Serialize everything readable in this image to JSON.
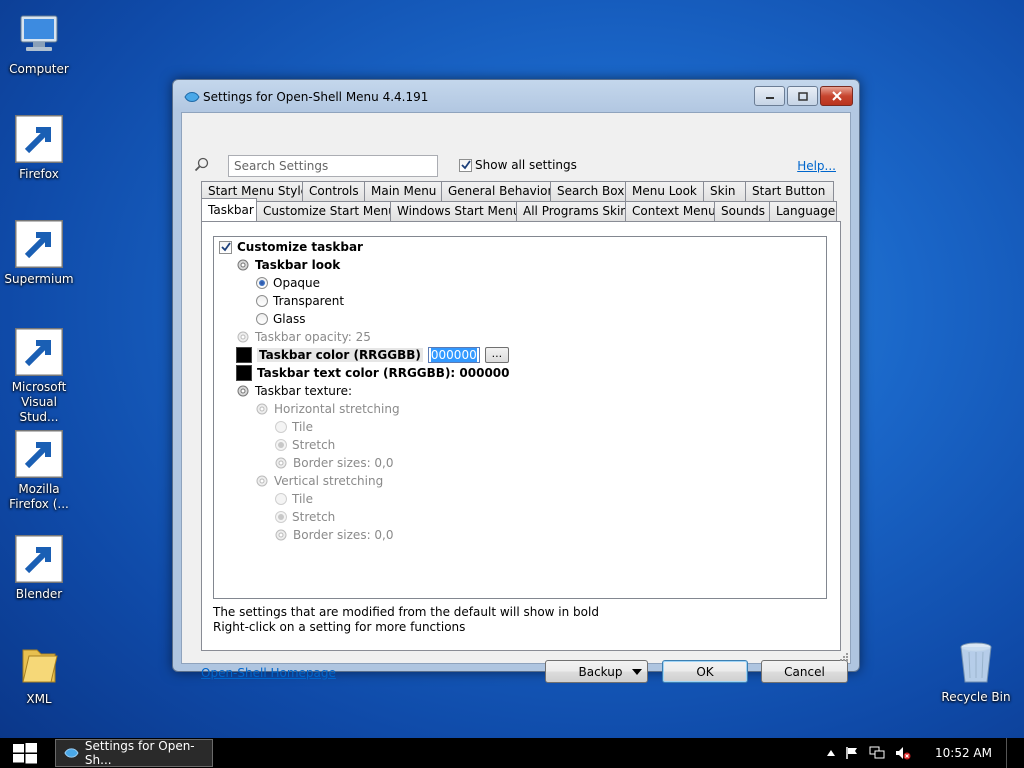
{
  "desktop": {
    "icons": [
      {
        "label": "Computer"
      },
      {
        "label": "Firefox"
      },
      {
        "label": "Supermium"
      },
      {
        "label": "Microsoft Visual Stud..."
      },
      {
        "label": "Mozilla Firefox (..."
      },
      {
        "label": "Blender"
      },
      {
        "label": "XML"
      },
      {
        "label": "Recycle Bin"
      }
    ]
  },
  "window": {
    "title": "Settings for Open-Shell Menu 4.4.191",
    "search_placeholder": "Search Settings",
    "show_all_label": "Show all settings",
    "help_label": "Help...",
    "tabs_row1": [
      "Start Menu Style",
      "Controls",
      "Main Menu",
      "General Behavior",
      "Search Box",
      "Menu Look",
      "Skin",
      "Start Button"
    ],
    "tabs_row2": [
      "Taskbar",
      "Customize Start Menu",
      "Windows Start Menu",
      "All Programs Skin",
      "Context Menu",
      "Sounds",
      "Language"
    ],
    "active_tab": "Taskbar",
    "tree": {
      "customize_taskbar": "Customize taskbar",
      "taskbar_look": "Taskbar look",
      "opaque": "Opaque",
      "transparent": "Transparent",
      "glass": "Glass",
      "taskbar_opacity": "Taskbar opacity: 25",
      "taskbar_color_label": "Taskbar color (RRGGBB)",
      "taskbar_color_value": "000000",
      "browse_label": "...",
      "taskbar_text_color": "Taskbar text color (RRGGBB): 000000",
      "taskbar_texture": "Taskbar texture:",
      "horizontal_stretching": "Horizontal stretching",
      "h_tile": "Tile",
      "h_stretch": "Stretch",
      "h_border": "Border sizes: 0,0",
      "vertical_stretching": "Vertical stretching",
      "v_tile": "Tile",
      "v_stretch": "Stretch",
      "v_border": "Border sizes: 0,0"
    },
    "info_line1": "The settings that are modified from the default will show in bold",
    "info_line2": "Right-click on a setting for more functions",
    "homepage_label": "Open-Shell Homepage",
    "backup_label": "Backup",
    "ok_label": "OK",
    "cancel_label": "Cancel"
  },
  "taskbar": {
    "task_label": "Settings for Open-Sh...",
    "clock": "10:52 AM"
  },
  "colors": {
    "selection": "#3399ff",
    "link": "#0066cc",
    "close_button": "#c7452f"
  }
}
